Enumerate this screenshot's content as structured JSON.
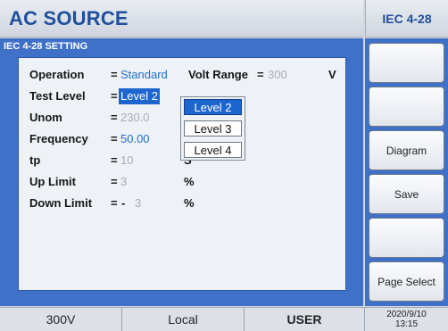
{
  "header": {
    "title": "AC SOURCE",
    "mode": "IEC 4-28"
  },
  "panel": {
    "title": "IEC 4-28 SETTING"
  },
  "settings": {
    "operation": {
      "label": "Operation",
      "eq": "=",
      "value": "Standard"
    },
    "volt_range": {
      "label": "Volt Range",
      "eq": "=",
      "value": "300",
      "unit": "V"
    },
    "test_level": {
      "label": "Test Level",
      "eq": "=",
      "value": "Level 2"
    },
    "unom": {
      "label": "Unom",
      "eq": "=",
      "value": "230.0"
    },
    "frequency": {
      "label": "Frequency",
      "eq": "=",
      "value": "50.00"
    },
    "tp": {
      "label": "tp",
      "eq": "=",
      "value": "10",
      "unit": "S"
    },
    "up_limit": {
      "label": "Up Limit",
      "eq": "=",
      "value": "3",
      "unit": "%"
    },
    "down_limit": {
      "label": "Down Limit",
      "eq": "=",
      "sign": "-",
      "value": "3",
      "unit": "%"
    }
  },
  "dropdown": {
    "options": [
      "Level 2",
      "Level 3",
      "Level 4"
    ],
    "selected": "Level 2"
  },
  "softkeys": [
    "",
    "",
    "Diagram",
    "Save",
    "",
    "Page Select"
  ],
  "status": {
    "range": "300V",
    "control": "Local",
    "user": "USER",
    "date": "2020/9/10",
    "time": "13:15"
  },
  "colors": {
    "accent_blue": "#3f71c9",
    "title_blue": "#1f4f9c",
    "selection_blue": "#1d66cf",
    "dim_value": "#a7adb6"
  }
}
